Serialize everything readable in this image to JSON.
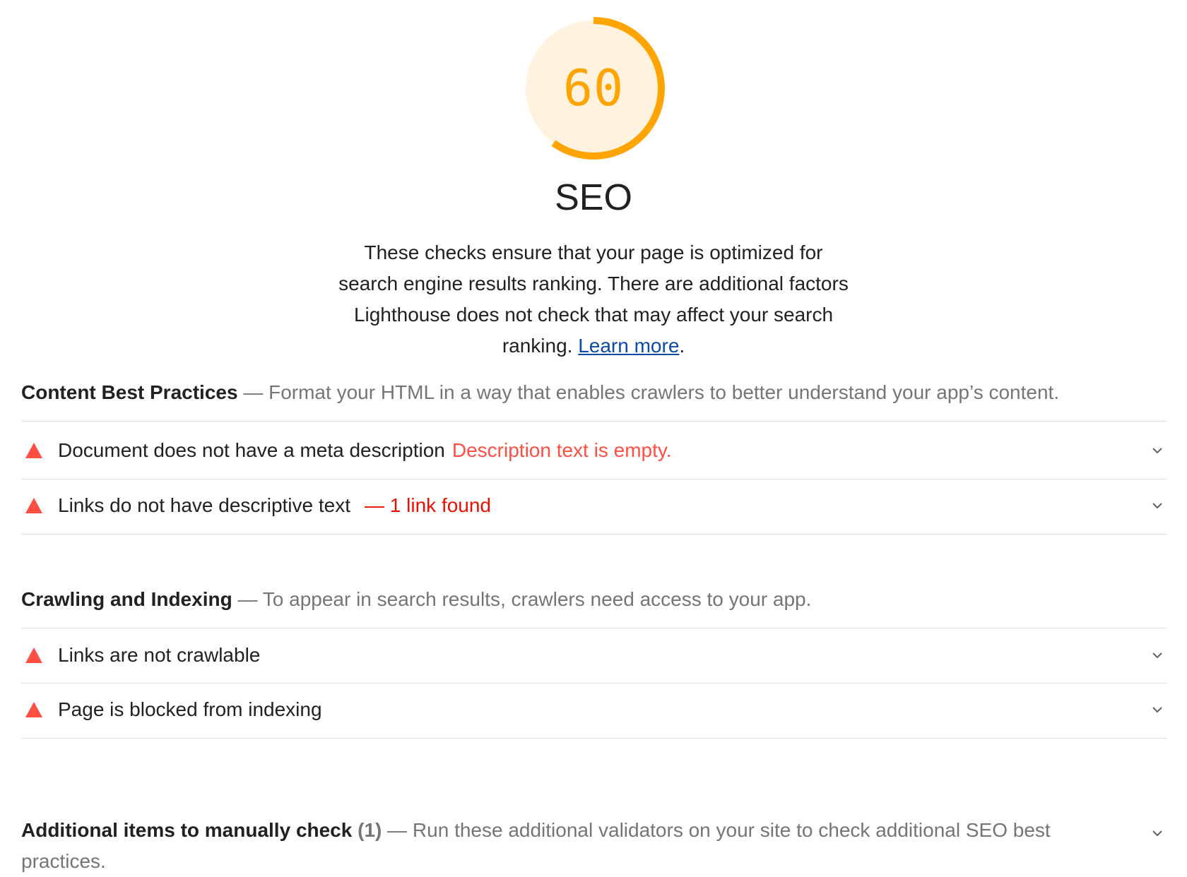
{
  "gauge": {
    "score": "60",
    "score_fraction": 0.6,
    "color": "#ffa400",
    "track_color": "#fff3e0"
  },
  "category": {
    "title": "SEO",
    "description": "These checks ensure that your page is optimized for search engine results ranking. There are additional factors Lighthouse does not check that may affect your search ranking. ",
    "learn_more": "Learn more",
    "period": "."
  },
  "groups": [
    {
      "title": "Content Best Practices",
      "separator": " — ",
      "description": "Format your HTML in a way that enables crawlers to better understand your app’s content.",
      "audits": [
        {
          "title": "Document does not have a meta description",
          "explanation": "Description text is empty.",
          "status_icon": "fail-triangle-icon"
        },
        {
          "title": "Links do not have descriptive text",
          "display_value": "— 1 link found",
          "status_icon": "fail-triangle-icon"
        }
      ]
    },
    {
      "title": "Crawling and Indexing",
      "separator": " — ",
      "description": "To appear in search results, crawlers need access to your app.",
      "audits": [
        {
          "title": "Links are not crawlable",
          "status_icon": "fail-triangle-icon"
        },
        {
          "title": "Page is blocked from indexing",
          "status_icon": "fail-triangle-icon"
        }
      ]
    }
  ],
  "manual_group": {
    "title": "Additional items to manually check",
    "count": "(1)",
    "separator": " — ",
    "description": "Run these additional validators on your site to check additional SEO best practices.",
    "expand_icon": "chevron-down-icon"
  },
  "colors": {
    "fail": "#ff4e42",
    "fail_text": "#eb0f00",
    "link": "#0b4aa8",
    "muted": "#757575",
    "divider": "#e0e0e0"
  }
}
